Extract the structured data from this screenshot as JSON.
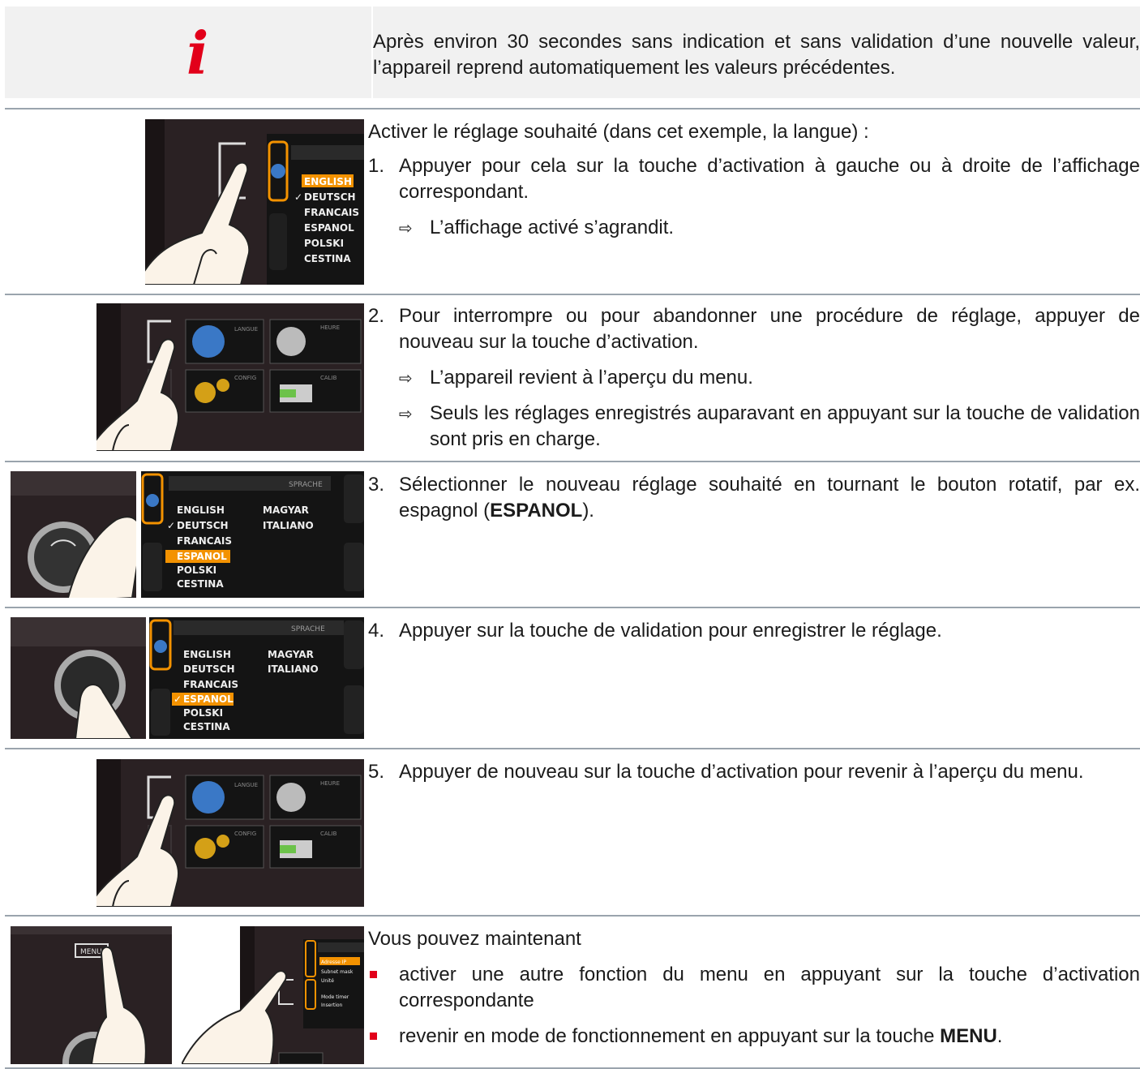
{
  "info": {
    "icon": "info-icon",
    "icon_glyph": "i",
    "text": "Après environ 30 secondes sans indication et sans validation d’une nouvelle valeur, l’appareil reprend automatiquement les valeurs précédentes."
  },
  "intro": "Activer le réglage souhaité (dans cet exemple, la langue) :",
  "steps": [
    {
      "num": "1.",
      "text": "Appuyer pour cela sur la touche d’activation à gauche ou à droite de l’affichage correspondant.",
      "results": [
        "L’affichage activé s’agrandit."
      ]
    },
    {
      "num": "2.",
      "text": "Pour interrompre ou pour abandonner une procédure de réglage, appuyer de nouveau sur la touche d’activation.",
      "results": [
        "L’appareil revient à l’aperçu du menu.",
        "Seuls les réglages enregistrés auparavant en appuyant sur la touche de validation sont pris en charge."
      ]
    },
    {
      "num": "3.",
      "text_before": "Sélectionner le nouveau réglage souhaité en tournant le bouton rotatif, par ex. espagnol (",
      "text_bold": "ESPANOL",
      "text_after": ")."
    },
    {
      "num": "4.",
      "text": "Appuyer sur la touche de validation pour enregistrer le réglage."
    },
    {
      "num": "5.",
      "text": "Appuyer de nouveau sur la touche d’activation pour revenir à l’aperçu du menu."
    }
  ],
  "closing": {
    "lead": "Vous pouvez maintenant",
    "bullets": [
      {
        "text": "activer une autre fonction du menu en appuyant sur la touche d’activation correspondante"
      },
      {
        "text_before": "revenir en mode de fonctionnement en appuyant sur la touche ",
        "text_bold": "MENU",
        "text_after": "."
      }
    ]
  },
  "result_arrow": "⇨",
  "screens": {
    "lang_list": [
      "ENGLISH",
      "DEUTSCH",
      "FRANCAIS",
      "ESPANOL",
      "POLSKI",
      "CESTINA"
    ],
    "lang_list_right": [
      "MAGYAR",
      "ITALIANO"
    ],
    "sprache": "SPRACHE",
    "check": "✓",
    "tiles": [
      "LANGUE",
      "HEURE",
      "CONFIG",
      "CALIB"
    ],
    "menu_key": "MENU",
    "net_items": [
      "Adresse IP",
      "Subnet mask",
      "Unité",
      "Mode timer",
      "Insertion"
    ]
  },
  "colors": {
    "accent_red": "#e2001a",
    "highlight_orange": "#f39200",
    "screen_dark": "#141414",
    "panel_dark": "#2a2123"
  }
}
